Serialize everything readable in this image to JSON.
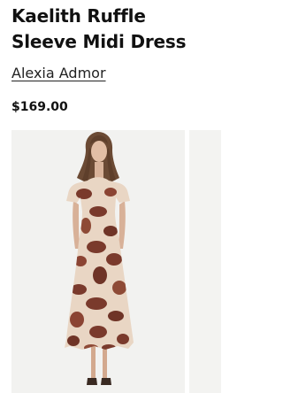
{
  "product": {
    "title": "Kaelith Ruffle Sleeve Midi Dress",
    "brand": "Alexia Admor",
    "price": "$169.00"
  },
  "gallery": {
    "images": [
      {
        "icon": "dress-photo",
        "current": true
      },
      {
        "icon": "dress-photo",
        "current": false
      }
    ]
  },
  "colors": {
    "background": "#ffffff",
    "text": "#111111",
    "photo_background": "#f2f2f0",
    "dress_base": "#e9d6c4",
    "dress_print": "#7a3a2c"
  }
}
